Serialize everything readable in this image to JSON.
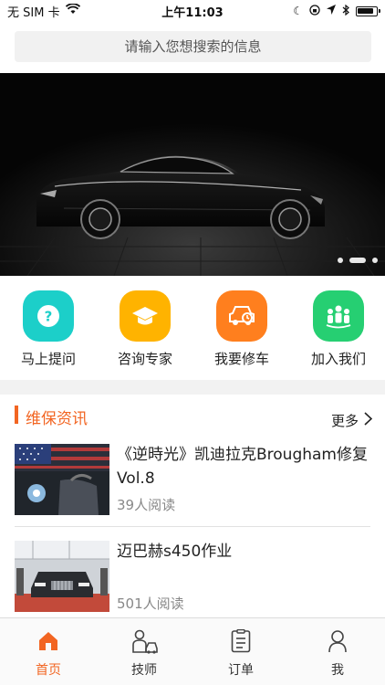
{
  "status_bar": {
    "carrier": "无 SIM 卡",
    "time": "上午11:03"
  },
  "search": {
    "placeholder": "请输入您想搜索的信息"
  },
  "banner": {
    "slide_count": 3,
    "active_slide": 2
  },
  "quick_actions": [
    {
      "label": "马上提问",
      "color": "#1ccfc9",
      "icon": "question-icon"
    },
    {
      "label": "咨询专家",
      "color": "#ffb300",
      "icon": "graduation-cap-icon"
    },
    {
      "label": "我要修车",
      "color": "#ff7f1e",
      "icon": "car-repair-icon"
    },
    {
      "label": "加入我们",
      "color": "#26cf72",
      "icon": "group-icon"
    }
  ],
  "news": {
    "section_title": "维保资讯",
    "more_label": "更多",
    "items": [
      {
        "title": "《逆時光》凯迪拉克Brougham修复 Vol.8",
        "reads": "39人阅读"
      },
      {
        "title": "迈巴赫s450作业",
        "reads": "501人阅读"
      }
    ]
  },
  "tabs": [
    {
      "label": "首页",
      "icon": "home-icon",
      "active": true
    },
    {
      "label": "技师",
      "icon": "technician-icon",
      "active": false
    },
    {
      "label": "订单",
      "icon": "order-icon",
      "active": false
    },
    {
      "label": "我",
      "icon": "user-icon",
      "active": false
    }
  ],
  "colors": {
    "accent": "#f26522"
  }
}
